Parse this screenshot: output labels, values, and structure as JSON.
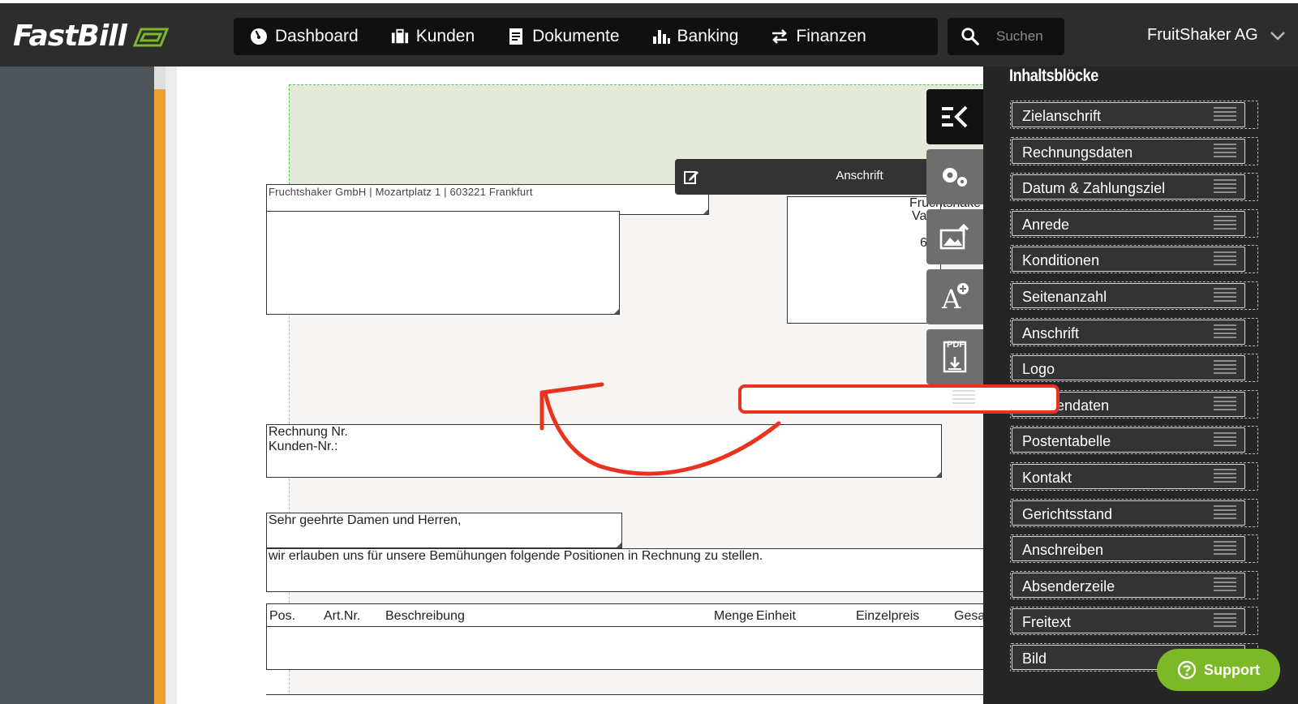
{
  "brand": {
    "name": "FastBill",
    "accent": "#7cb828"
  },
  "nav": {
    "items": [
      {
        "label": "Dashboard",
        "icon": "gauge-icon"
      },
      {
        "label": "Kunden",
        "icon": "briefcase-icon"
      },
      {
        "label": "Dokumente",
        "icon": "document-icon"
      },
      {
        "label": "Banking",
        "icon": "bar-chart-icon"
      },
      {
        "label": "Finanzen",
        "icon": "transfer-icon"
      }
    ],
    "search_placeholder": "Suchen",
    "company": "FruitShaker AG"
  },
  "document": {
    "sender_line": "Fruchtshaker GmbH | Mozartplatz 1 | 603221 Frankfurt",
    "right_address_lines": [
      "Fruchtshake",
      "Va",
      "6"
    ],
    "invoice_line1": "Rechnung Nr.",
    "invoice_line2": "Kunden-Nr.:",
    "salutation": "Sehr geehrte Damen und Herren,",
    "intro_text": "wir erlauben uns für unsere Bemühungen folgende Positionen in Rechnung zu stellen.",
    "table_headers": [
      "Pos.",
      "Art.Nr.",
      "Beschreibung",
      "Menge",
      "Einheit",
      "Einzelpreis",
      "Gesa"
    ]
  },
  "edit_bar": {
    "label": "Anschrift"
  },
  "tools": [
    {
      "icon": "collapse-panel-icon"
    },
    {
      "icon": "settings-gears-icon"
    },
    {
      "icon": "image-upload-icon"
    },
    {
      "icon": "add-font-icon"
    },
    {
      "icon": "pdf-download-icon",
      "text": "PDF"
    }
  ],
  "panel": {
    "title": "Inhaltsblöcke",
    "blocks": [
      "Zielanschrift",
      "Rechnungsdaten",
      "Datum & Zahlungsziel",
      "Anrede",
      "Konditionen",
      "Seitenanzahl",
      "Anschrift",
      "Logo",
      "Kundendaten",
      "Postentabelle",
      "Kontakt",
      "Gerichtsstand",
      "Anschreiben",
      "Absenderzeile",
      "Freitext",
      "Bild"
    ]
  },
  "support": {
    "label": "Support"
  },
  "annotation": {
    "color": "#e8331f"
  }
}
